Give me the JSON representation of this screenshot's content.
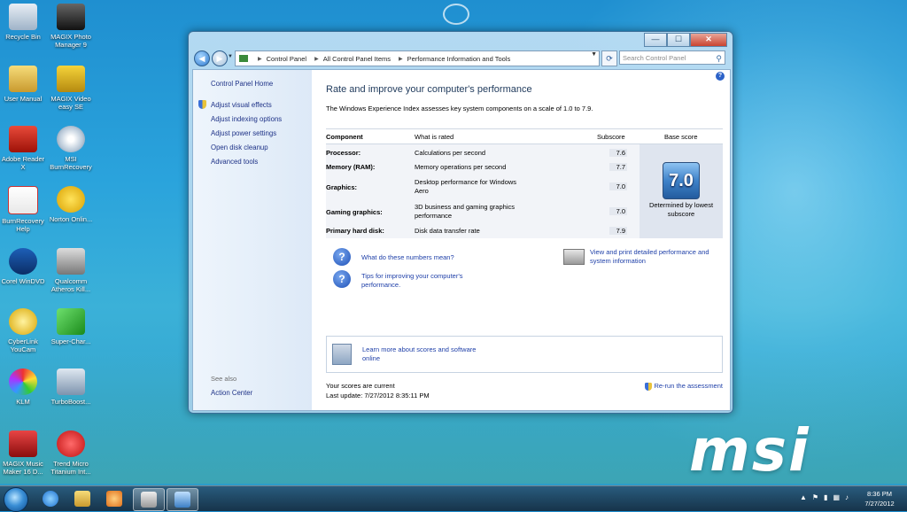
{
  "desktop": {
    "icons": [
      {
        "label": "Recycle Bin",
        "icon": "recycle-bin-icon"
      },
      {
        "label": "MAGIX Photo Manager 9",
        "icon": "camera-icon"
      },
      {
        "label": "User Manual",
        "icon": "folder-icon"
      },
      {
        "label": "MAGIX Video easy SE",
        "icon": "video-icon"
      },
      {
        "label": "Adobe Reader X",
        "icon": "pdf-icon"
      },
      {
        "label": "MSI BurnRecovery",
        "icon": "disc-icon"
      },
      {
        "label": "BurnRecovery Help",
        "icon": "pdf-doc-icon"
      },
      {
        "label": "Norton Onlin...",
        "icon": "norton-icon"
      },
      {
        "label": "Corel WinDVD",
        "icon": "dvd-icon"
      },
      {
        "label": "Qualcomm Atheros Kill...",
        "icon": "killer-icon"
      },
      {
        "label": "CyberLink YouCam",
        "icon": "webcam-icon"
      },
      {
        "label": "Super-Char...",
        "icon": "charge-icon"
      },
      {
        "label": "KLM",
        "icon": "klm-icon"
      },
      {
        "label": "TurboBoost...",
        "icon": "turbo-icon"
      },
      {
        "label": "MAGIX Music Maker 16 D...",
        "icon": "music-icon"
      },
      {
        "label": "Trend Micro Titanium Int...",
        "icon": "trend-micro-icon"
      }
    ],
    "brand_logo": "msi"
  },
  "window": {
    "controls": {
      "minimize": "—",
      "maximize": "☐",
      "close": "✕"
    },
    "breadcrumb": [
      "Control Panel",
      "All Control Panel Items",
      "Performance Information and Tools"
    ],
    "search_placeholder": "Search Control Panel",
    "left_pane": {
      "home": "Control Panel Home",
      "tasks": [
        "Adjust visual effects",
        "Adjust indexing options",
        "Adjust power settings",
        "Open disk cleanup",
        "Advanced tools"
      ],
      "see_also_label": "See also",
      "see_also": [
        "Action Center"
      ]
    },
    "main": {
      "title": "Rate and improve your computer's performance",
      "description": "The Windows Experience Index assesses key system components on a scale of 1.0 to 7.9.",
      "table": {
        "headers": {
          "component": "Component",
          "rated": "What is rated",
          "subscore": "Subscore",
          "base": "Base score"
        },
        "rows": [
          {
            "component": "Processor:",
            "rated": "Calculations per second",
            "score": "7.6"
          },
          {
            "component": "Memory (RAM):",
            "rated": "Memory operations per second",
            "score": "7.7"
          },
          {
            "component": "Graphics:",
            "rated": "Desktop performance for Windows Aero",
            "score": "7.0"
          },
          {
            "component": "Gaming graphics:",
            "rated": "3D business and gaming graphics performance",
            "score": "7.0"
          },
          {
            "component": "Primary hard disk:",
            "rated": "Disk data transfer rate",
            "score": "7.9"
          }
        ],
        "base_score": "7.0",
        "base_note": "Determined by lowest subscore"
      },
      "links": {
        "numbers": "What do these numbers mean?",
        "tips": "Tips for improving your computer's performance.",
        "print": "View and print detailed performance and system information",
        "learn": "Learn more about scores and software online"
      },
      "status": {
        "current": "Your scores are current",
        "last_update": "Last update: 7/27/2012 8:35:11 PM",
        "rerun": "Re-run the assessment"
      }
    }
  },
  "taskbar": {
    "clock_time": "8:36 PM",
    "clock_date": "7/27/2012"
  }
}
